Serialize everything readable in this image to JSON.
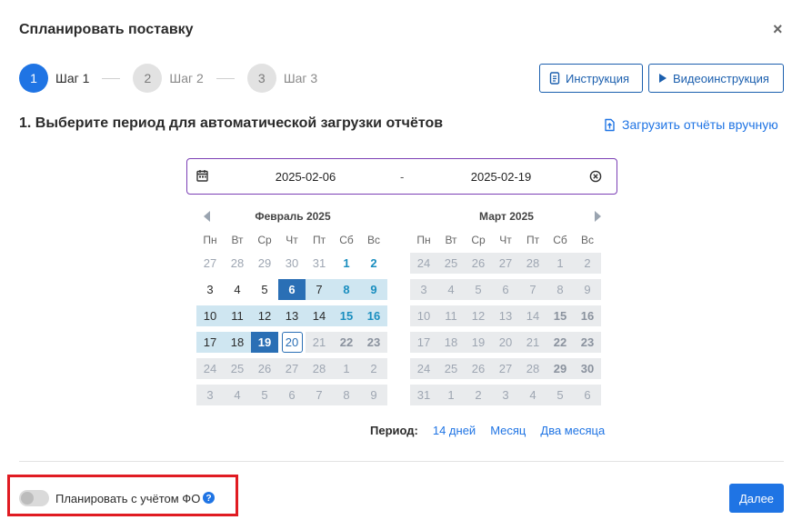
{
  "dialog": {
    "title": "Спланировать поставку",
    "close_icon": "×"
  },
  "steps": [
    {
      "number": "1",
      "label": "Шаг 1",
      "active": true
    },
    {
      "number": "2",
      "label": "Шаг 2",
      "active": false
    },
    {
      "number": "3",
      "label": "Шаг 3",
      "active": false
    }
  ],
  "header_buttons": {
    "instruction": "Инструкция",
    "video_instruction": "Видеоинструкция"
  },
  "section": {
    "title": "1. Выберите период для автоматической загрузки отчётов",
    "upload_link": "Загрузить отчёты вручную"
  },
  "date_range": {
    "from": "2025-02-06",
    "separator": "-",
    "to": "2025-02-19"
  },
  "calendar": {
    "weekdays": [
      "Пн",
      "Вт",
      "Ср",
      "Чт",
      "Пт",
      "Сб",
      "Вс"
    ],
    "months": [
      {
        "name": "Февраль 2025",
        "days": [
          {
            "d": "27",
            "s": "muted"
          },
          {
            "d": "28",
            "s": "muted"
          },
          {
            "d": "29",
            "s": "muted"
          },
          {
            "d": "30",
            "s": "muted"
          },
          {
            "d": "31",
            "s": "muted"
          },
          {
            "d": "1",
            "s": "weekend"
          },
          {
            "d": "2",
            "s": "weekend"
          },
          {
            "d": "3",
            "s": ""
          },
          {
            "d": "4",
            "s": ""
          },
          {
            "d": "5",
            "s": ""
          },
          {
            "d": "6",
            "s": "sel"
          },
          {
            "d": "7",
            "s": "range"
          },
          {
            "d": "8",
            "s": "range weekend"
          },
          {
            "d": "9",
            "s": "range weekend"
          },
          {
            "d": "10",
            "s": "range"
          },
          {
            "d": "11",
            "s": "range"
          },
          {
            "d": "12",
            "s": "range"
          },
          {
            "d": "13",
            "s": "range"
          },
          {
            "d": "14",
            "s": "range"
          },
          {
            "d": "15",
            "s": "range weekend"
          },
          {
            "d": "16",
            "s": "range weekend"
          },
          {
            "d": "17",
            "s": "range"
          },
          {
            "d": "18",
            "s": "range"
          },
          {
            "d": "19",
            "s": "sel"
          },
          {
            "d": "20",
            "s": "today"
          },
          {
            "d": "21",
            "s": "grey"
          },
          {
            "d": "22",
            "s": "grey wk"
          },
          {
            "d": "23",
            "s": "grey wk"
          },
          {
            "d": "24",
            "s": "grey"
          },
          {
            "d": "25",
            "s": "grey"
          },
          {
            "d": "26",
            "s": "grey"
          },
          {
            "d": "27",
            "s": "grey"
          },
          {
            "d": "28",
            "s": "grey"
          },
          {
            "d": "1",
            "s": "grey"
          },
          {
            "d": "2",
            "s": "grey"
          },
          {
            "d": "3",
            "s": "grey"
          },
          {
            "d": "4",
            "s": "grey"
          },
          {
            "d": "5",
            "s": "grey"
          },
          {
            "d": "6",
            "s": "grey"
          },
          {
            "d": "7",
            "s": "grey"
          },
          {
            "d": "8",
            "s": "grey"
          },
          {
            "d": "9",
            "s": "grey"
          }
        ]
      },
      {
        "name": "Март 2025",
        "days": [
          {
            "d": "24",
            "s": "grey"
          },
          {
            "d": "25",
            "s": "grey"
          },
          {
            "d": "26",
            "s": "grey"
          },
          {
            "d": "27",
            "s": "grey"
          },
          {
            "d": "28",
            "s": "grey"
          },
          {
            "d": "1",
            "s": "grey"
          },
          {
            "d": "2",
            "s": "grey"
          },
          {
            "d": "3",
            "s": "grey"
          },
          {
            "d": "4",
            "s": "grey"
          },
          {
            "d": "5",
            "s": "grey"
          },
          {
            "d": "6",
            "s": "grey"
          },
          {
            "d": "7",
            "s": "grey"
          },
          {
            "d": "8",
            "s": "grey"
          },
          {
            "d": "9",
            "s": "grey"
          },
          {
            "d": "10",
            "s": "grey"
          },
          {
            "d": "11",
            "s": "grey"
          },
          {
            "d": "12",
            "s": "grey"
          },
          {
            "d": "13",
            "s": "grey"
          },
          {
            "d": "14",
            "s": "grey"
          },
          {
            "d": "15",
            "s": "grey wk"
          },
          {
            "d": "16",
            "s": "grey wk"
          },
          {
            "d": "17",
            "s": "grey"
          },
          {
            "d": "18",
            "s": "grey"
          },
          {
            "d": "19",
            "s": "grey"
          },
          {
            "d": "20",
            "s": "grey"
          },
          {
            "d": "21",
            "s": "grey"
          },
          {
            "d": "22",
            "s": "grey wk"
          },
          {
            "d": "23",
            "s": "grey wk"
          },
          {
            "d": "24",
            "s": "grey"
          },
          {
            "d": "25",
            "s": "grey"
          },
          {
            "d": "26",
            "s": "grey"
          },
          {
            "d": "27",
            "s": "grey"
          },
          {
            "d": "28",
            "s": "grey"
          },
          {
            "d": "29",
            "s": "grey wk"
          },
          {
            "d": "30",
            "s": "grey wk"
          },
          {
            "d": "31",
            "s": "grey"
          },
          {
            "d": "1",
            "s": "grey"
          },
          {
            "d": "2",
            "s": "grey"
          },
          {
            "d": "3",
            "s": "grey"
          },
          {
            "d": "4",
            "s": "grey"
          },
          {
            "d": "5",
            "s": "grey"
          },
          {
            "d": "6",
            "s": "grey"
          }
        ]
      }
    ]
  },
  "period": {
    "label": "Период:",
    "options": [
      "14 дней",
      "Месяц",
      "Два месяца"
    ]
  },
  "footer": {
    "toggle_label": "Планировать с учётом ФО",
    "toggle_on": false,
    "next_button": "Далее"
  },
  "colors": {
    "accent": "#1f74e4",
    "selected_day": "#2a6fb5",
    "range_day": "#cfe6f1",
    "highlight_frame": "#e01b22",
    "date_field_border": "#7b3fb5"
  }
}
